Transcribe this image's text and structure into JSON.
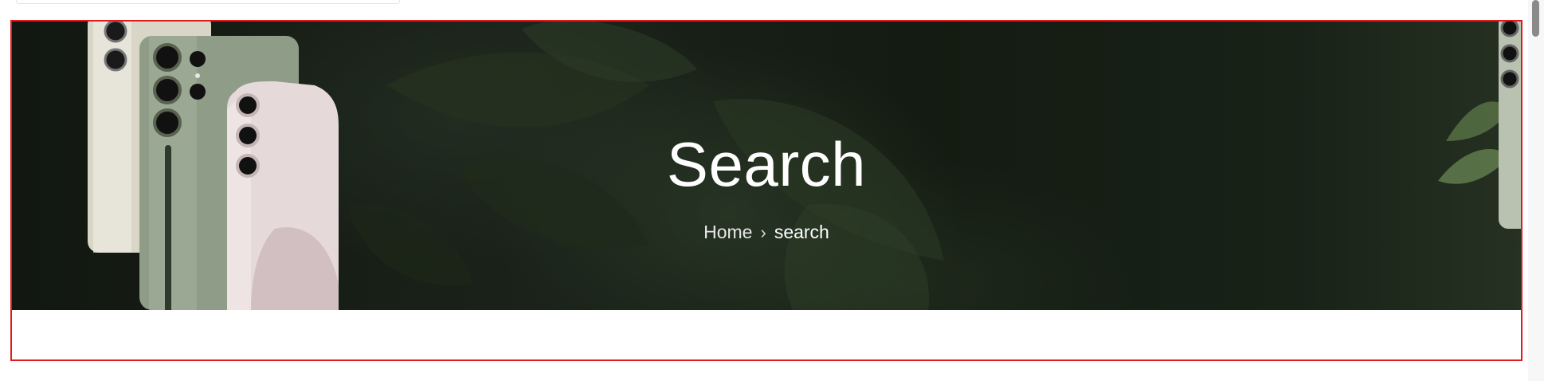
{
  "hero": {
    "title": "Search",
    "breadcrumb": {
      "home_label": "Home",
      "separator_icon": "chevron-right-icon",
      "separator_glyph": "›",
      "current_label": "search"
    },
    "background_image": "dark-green-leaves-with-phones"
  },
  "colors": {
    "highlight_border": "#e11b1b",
    "hero_text": "#ffffff"
  }
}
